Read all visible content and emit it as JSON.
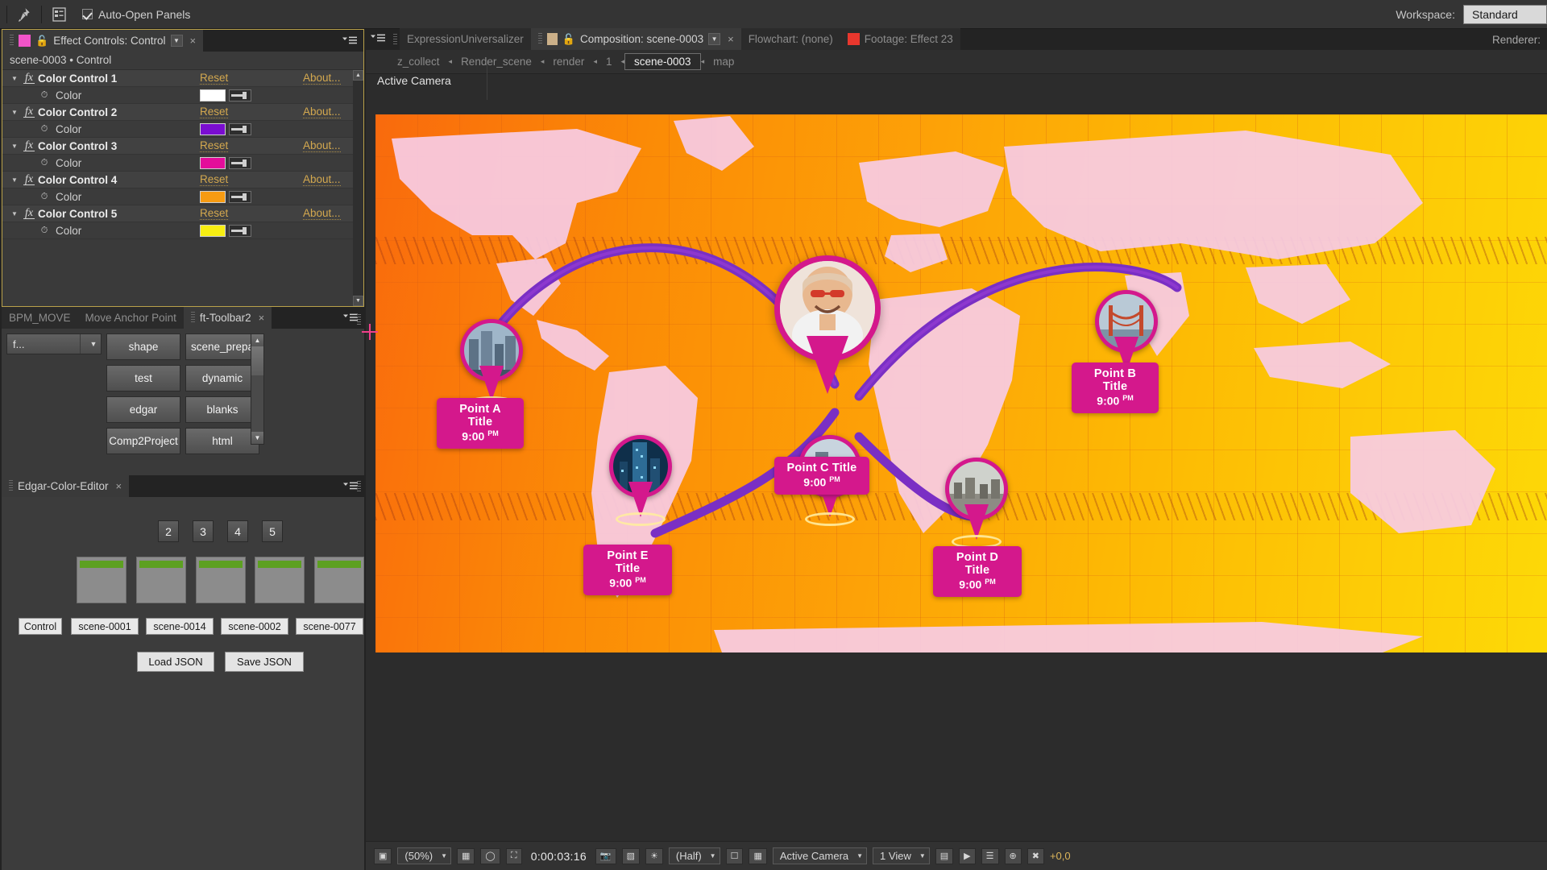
{
  "topbar": {
    "pin_icon": "pin-icon",
    "panels_icon": "panels-list-icon",
    "auto_open_label": "Auto-Open Panels",
    "workspace_label": "Workspace:",
    "workspace_value": "Standard"
  },
  "effect_controls": {
    "tab_label": "Effect Controls: Control",
    "tab_close": "×",
    "subtitle": "scene-0003 • Control",
    "reset_label": "Reset",
    "about_label": "About...",
    "property_label": "Color",
    "effects": [
      {
        "name": "Color Control 1",
        "color": "#ffffff"
      },
      {
        "name": "Color Control 2",
        "color": "#7a0dd1"
      },
      {
        "name": "Color Control 3",
        "color": "#e40d9a"
      },
      {
        "name": "Color Control 4",
        "color": "#f79b12"
      },
      {
        "name": "Color Control 5",
        "color": "#f7ee12"
      }
    ]
  },
  "ft_toolbar": {
    "tabs": [
      {
        "label": "BPM_MOVE",
        "active": false
      },
      {
        "label": "Move Anchor Point",
        "active": false
      },
      {
        "label": "ft-Toolbar2",
        "active": true,
        "close": "×"
      }
    ],
    "dropdown_value": "f...",
    "buttons": [
      "shape",
      "scene_prepa",
      "test",
      "dynamic",
      "edgar",
      "blanks",
      "Comp2Project",
      "html"
    ]
  },
  "edgar": {
    "tab_label": "Edgar-Color-Editor",
    "tab_close": "×",
    "number_buttons": [
      "2",
      "3",
      "4",
      "5"
    ],
    "color_cards": [
      {
        "bar_color": "#5da021"
      },
      {
        "bar_color": "#5da021"
      },
      {
        "bar_color": "#5da021"
      },
      {
        "bar_color": "#5da021"
      },
      {
        "bar_color": "#5da021"
      }
    ],
    "scene_buttons": [
      "Control",
      "scene-0001",
      "scene-0014",
      "scene-0002",
      "scene-0077"
    ],
    "load_json_label": "Load JSON",
    "save_json_label": "Save JSON"
  },
  "viewer": {
    "tabs": [
      {
        "label": "ExpressionUniversalizer",
        "active": false
      },
      {
        "label": "Composition: scene-0003",
        "active": true,
        "close": "×"
      },
      {
        "label": "Flowchart: (none)",
        "active": false
      },
      {
        "label": "Footage: Effect 23",
        "active": false
      }
    ],
    "breadcrumb": [
      "z_collect",
      "Render_scene",
      "render",
      "1",
      "scene-0003",
      "map"
    ],
    "breadcrumb_active": "scene-0003",
    "breadcrumb_arrow": "◂",
    "renderer_label": "Renderer:",
    "camera_label": "Active Camera",
    "bottom": {
      "zoom": "(50%)",
      "time": "0:00:03:16",
      "resolution": "(Half)",
      "camera": "Active Camera",
      "views": "1 View",
      "exposure": "+0,0"
    }
  },
  "map": {
    "pins": [
      {
        "id": "A",
        "title": "Point A Title",
        "time": "9:00",
        "meridiem": "PM"
      },
      {
        "id": "B",
        "title": "Point B Title",
        "time": "9:00",
        "meridiem": "PM"
      },
      {
        "id": "C",
        "title": "Point C Title",
        "time": "9:00",
        "meridiem": "PM"
      },
      {
        "id": "D",
        "title": "Point D Title",
        "time": "9:00",
        "meridiem": "PM"
      },
      {
        "id": "E",
        "title": "Point E Title",
        "time": "9:00",
        "meridiem": "PM"
      }
    ],
    "accent_color": "#d4188c",
    "arc_color": "#7a2fc4",
    "background_start": "#f96a0d",
    "background_end": "#fdd907",
    "land_color": "#f6c8e2"
  }
}
